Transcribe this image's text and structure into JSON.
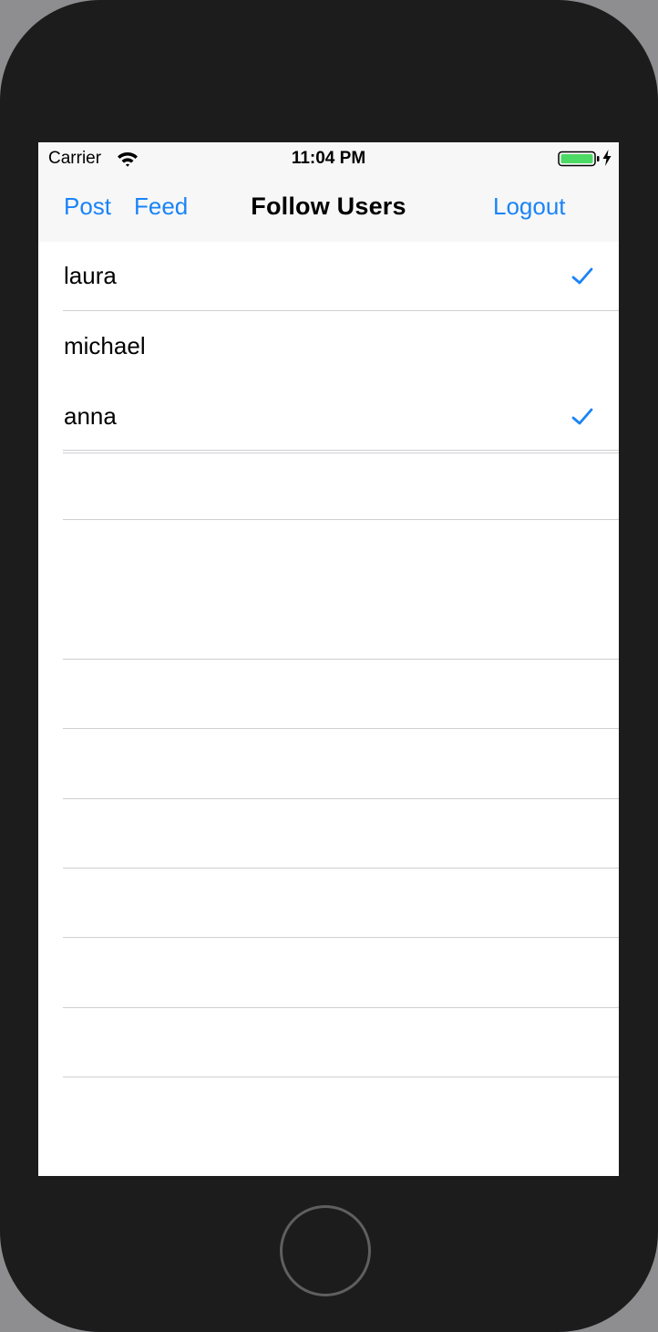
{
  "status_bar": {
    "carrier": "Carrier",
    "time": "11:04 PM",
    "wifi_icon": "wifi-icon",
    "battery_icon": "battery-full-icon",
    "charging_icon": "charging-bolt-icon",
    "battery_color": "#4cd964"
  },
  "nav_bar": {
    "left_buttons": [
      "Post",
      "Feed"
    ],
    "title": "Follow Users",
    "right_button": "Logout",
    "accent_color": "#1a84f7"
  },
  "users": [
    {
      "name": "laura",
      "following": true
    },
    {
      "name": "michael",
      "following": false
    },
    {
      "name": "anna",
      "following": true
    }
  ],
  "home_button": "home-button"
}
